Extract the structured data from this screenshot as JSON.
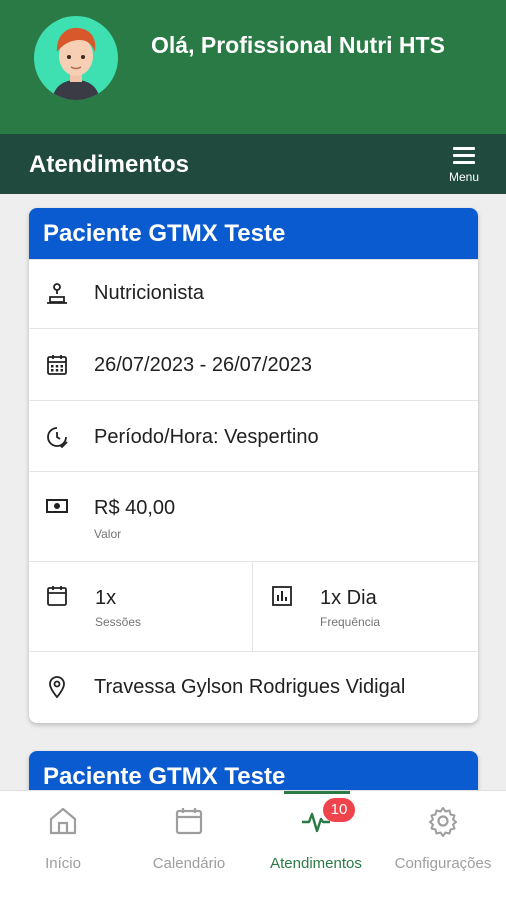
{
  "header": {
    "greeting": "Olá, Profissional Nutri HTS",
    "avatar_icon": "user-avatar-icon"
  },
  "titlebar": {
    "title": "Atendimentos",
    "menu_label": "Menu"
  },
  "appointments": [
    {
      "patient": "Paciente GTMX Teste",
      "specialty": "Nutricionista",
      "dates": "26/07/2023 - 26/07/2023",
      "period": "Período/Hora: Vespertino",
      "price": "R$ 40,00",
      "price_label": "Valor",
      "sessions": "1x",
      "sessions_label": "Sessões",
      "frequency": "1x Dia",
      "frequency_label": "Frequência",
      "address": "Travessa Gylson Rodrigues Vidigal"
    },
    {
      "patient": "Paciente GTMX Teste"
    }
  ],
  "bottom_nav": {
    "items": [
      {
        "label": "Início",
        "icon": "home-icon"
      },
      {
        "label": "Calendário",
        "icon": "calendar-icon"
      },
      {
        "label": "Atendimentos",
        "icon": "heartbeat-icon",
        "badge": "10",
        "active": true
      },
      {
        "label": "Configurações",
        "icon": "gear-icon"
      }
    ]
  },
  "colors": {
    "header_green": "#2a7a45",
    "titlebar_dark_green": "#1f4a3d",
    "card_blue": "#0a5bd0",
    "badge_red": "#f0444d",
    "avatar_teal": "#3ee0b1"
  }
}
